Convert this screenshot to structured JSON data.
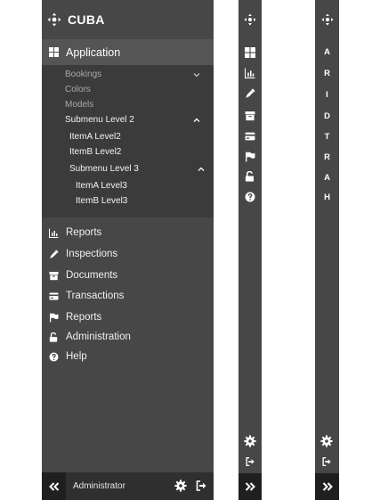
{
  "brand": {
    "name": "CUBA"
  },
  "expanded_menu": {
    "application": {
      "label": "Application"
    },
    "submenu": {
      "bookings": "Bookings",
      "colors": "Colors",
      "models": "Models",
      "submenu_level2": "Submenu Level 2",
      "itema_level2": "ItemA Level2",
      "itemb_level2": "ItemB Level2",
      "submenu_level3": "Submenu Level 3",
      "itema_level3": "ItemA Level3",
      "itemb_level3": "ItemB Level3"
    },
    "items": [
      {
        "label": "Reports",
        "icon": "bar-chart-icon"
      },
      {
        "label": "Inspections",
        "icon": "eyedropper-icon"
      },
      {
        "label": "Documents",
        "icon": "archive-icon"
      },
      {
        "label": "Transactions",
        "icon": "credit-card-icon"
      },
      {
        "label": "Reports",
        "icon": "flag-icon"
      },
      {
        "label": "Administration",
        "icon": "unlock-icon"
      },
      {
        "label": "Help",
        "icon": "question-icon"
      }
    ]
  },
  "footer": {
    "user": "Administrator"
  },
  "collapsed_letters": [
    "A",
    "R",
    "I",
    "D",
    "T",
    "R",
    "A",
    "H"
  ],
  "colors": {
    "panel": "#474747",
    "highlight": "#555555",
    "submenu_bg": "#3b3b3b",
    "bottom_bar": "#2f2f2f",
    "toggle": "#1f1f1f"
  }
}
